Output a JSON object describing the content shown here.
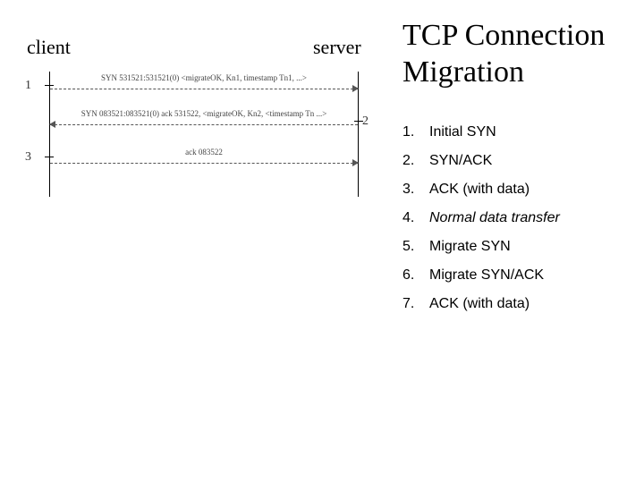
{
  "diagram": {
    "client_label": "client",
    "server_label": "server",
    "messages": {
      "m1": {
        "num": "1",
        "text": "SYN 531521:531521(0)\n<migrateOK, Kn1, timestamp Tn1, ...>"
      },
      "m2": {
        "num": "2",
        "text": "SYN 083521:083521(0)\nack 531522, <migrateOK, Kn2, <timestamp Tn ...>"
      },
      "m3": {
        "num": "3",
        "text": "ack 083522"
      }
    }
  },
  "title": "TCP Connection Migration",
  "steps": [
    {
      "n": "1.",
      "t": "Initial SYN",
      "italic": false
    },
    {
      "n": "2.",
      "t": "SYN/ACK",
      "italic": false
    },
    {
      "n": "3.",
      "t": "ACK (with data)",
      "italic": false
    },
    {
      "n": "4.",
      "t": "Normal data transfer",
      "italic": true
    },
    {
      "n": "5.",
      "t": "Migrate SYN",
      "italic": false
    },
    {
      "n": "6.",
      "t": "Migrate SYN/ACK",
      "italic": false
    },
    {
      "n": "7.",
      "t": "ACK (with data)",
      "italic": false
    }
  ]
}
